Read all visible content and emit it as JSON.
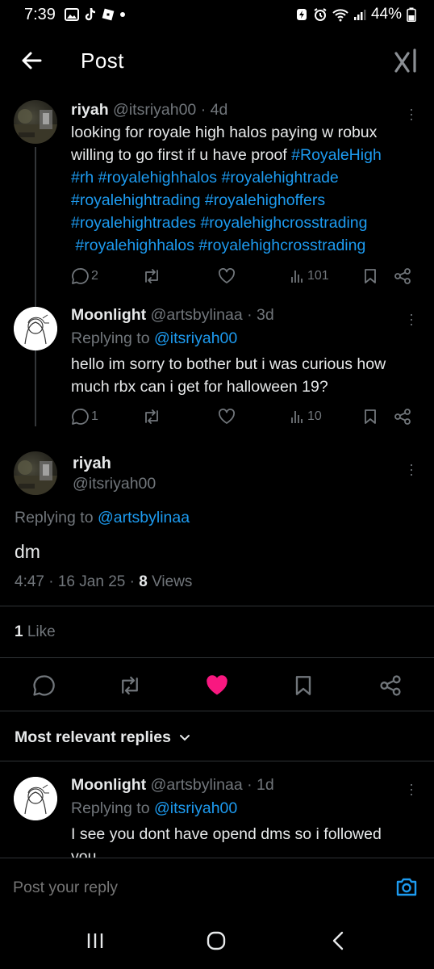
{
  "status_bar": {
    "time": "7:39",
    "battery": "44%"
  },
  "header": {
    "title": "Post"
  },
  "thread_post": {
    "name": "riyah",
    "handle": "@itsriyah00",
    "time": "· 4d",
    "lines": [
      "looking for royale high halos paying w robux",
      "willing to go first if u have proof ",
      "",
      "",
      "",
      ""
    ],
    "hashtags": {
      "h1": "#RoyaleHigh",
      "h2": "#rh",
      "h3": "#royalehighhalos",
      "h4": "#royalehightrade",
      "h5": "#royalehightrading",
      "h6": "#royalehighoffers",
      "h7": "#royalehightrades",
      "h8": "#royalehighcrosstrading",
      "h9": "#royalehighhalos",
      "h10": "#royalehighcrosstrading"
    },
    "replies": "2",
    "views": "101"
  },
  "first_reply": {
    "name": "Moonlight",
    "handle": "@artsbylinaa",
    "time": "· 3d",
    "replying_label": "Replying to ",
    "replying_to": "@itsriyah00",
    "line1": "hello im sorry to bother but i was curious how",
    "line2": "much rbx can i get for halloween 19?",
    "replies": "1",
    "views": "10"
  },
  "main_post": {
    "name": "riyah",
    "handle": "@itsriyah00",
    "replying_label": "Replying to ",
    "replying_to": "@artsbylinaa",
    "text": "dm",
    "timestamp": "4:47 · 16 Jan 25 · ",
    "views_count": "8",
    "views_label": " Views",
    "likes_count": "1",
    "likes_label": " Like"
  },
  "replies_section": {
    "sort_label": "Most relevant replies"
  },
  "bottom_reply": {
    "name": "Moonlight",
    "handle": "@artsbylinaa",
    "time": "· 1d",
    "replying_label": "Replying to ",
    "replying_to": "@itsriyah00",
    "line1": "I see you dont have opend dms so i followed",
    "line2": "you"
  },
  "reply_input": {
    "placeholder": "Post your reply"
  },
  "colors": {
    "accent": "#1d9bf0",
    "like": "#f91880",
    "muted": "#71767b"
  }
}
